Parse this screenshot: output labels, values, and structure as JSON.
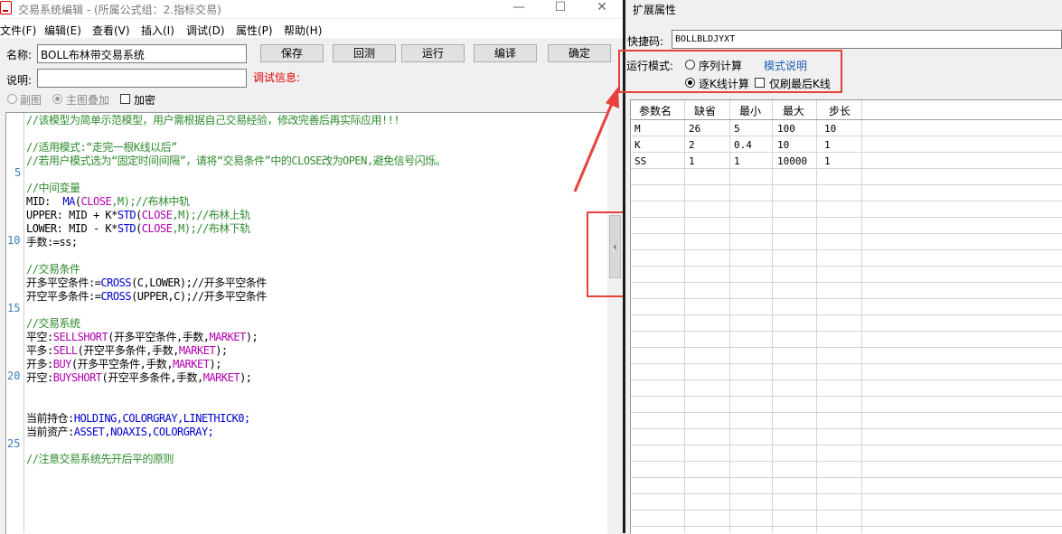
{
  "window": {
    "title": "交易系统编辑 - (所属公式组：2.指标交易)",
    "minimize": "—",
    "maximize": "☐",
    "close": "✕"
  },
  "menu": [
    "文件(F)",
    "编辑(E)",
    "查看(V)",
    "插入(I)",
    "调试(D)",
    "属性(P)",
    "帮助(H)"
  ],
  "form": {
    "name_label": "名称:",
    "name_value": "BOLL布林带交易系统",
    "desc_label": "说明:",
    "desc_value": "",
    "debug_info": "调试信息:",
    "buttons": {
      "save": "保存",
      "backtest": "回测",
      "run": "运行",
      "compile": "编译",
      "ok": "确定"
    },
    "sub_chart": "副图",
    "main_overlay": "主图叠加",
    "encrypt": "加密"
  },
  "editor": {
    "line_numbers": [
      "5",
      "10",
      "15",
      "20",
      "25"
    ],
    "lines": [
      "//该模型为简单示范模型，用户需根据自己交易经验，修改完善后再实际应用!!!",
      "//适用模式:“走完一根K线以后”",
      "//若用户模式选为“固定时间间隔”，请将“交易条件”中的CLOSE改为OPEN,避免信号闪烁。",
      "//中间变量",
      "MID:",
      "MA",
      "(",
      "CLOSE",
      ",M);//布林中轨",
      "UPPER: MID + K*",
      "STD",
      "(",
      "CLOSE",
      ",M);//布林上轨",
      "LOWER: MID - K*",
      "STD",
      "(",
      "CLOSE",
      ",M);//布林下轨",
      "手数:=ss;",
      "//交易条件",
      "开多平空条件:=",
      "CROSS",
      "(C,LOWER);//开多平空条件",
      "开空平多条件:=",
      "CROSS",
      "(UPPER,C);//开多平空条件",
      "//交易系统",
      "平空:",
      "SELLSHORT",
      "(开多平空条件,手数,",
      "MARKET",
      ");",
      "平多:",
      "SELL",
      "(开空平多条件,手数,",
      "MARKET",
      ");",
      "开多:",
      "BUY",
      "(开多平空条件,手数,",
      "MARKET",
      ");",
      "开空:",
      "BUYSHORT",
      "(开空平多条件,手数,",
      "MARKET",
      ");",
      "当前持仓:",
      "HOLDING,COLORGRAY,LINETHICK0;",
      "当前资产:",
      "ASSET,NOAXIS,COLORGRAY;",
      "//注意交易系统先开后平的原则"
    ]
  },
  "panel": {
    "title": "扩展属性",
    "shortcut_label": "快捷码:",
    "shortcut_value": "BOLLBLDJYXT",
    "mode_label": "运行模式:",
    "mode_series": "序列计算",
    "mode_tick": "逐K线计算",
    "mode_help": "模式说明",
    "last_bar_only": "仅刷最后K线",
    "collapse_glyph": "‹",
    "table_headers": [
      "参数名",
      "缺省",
      "最小",
      "最大",
      "步长"
    ],
    "table_rows": [
      [
        "M",
        "26",
        "5",
        "100",
        "10"
      ],
      [
        "K",
        "2",
        "0.4",
        "10",
        "1"
      ],
      [
        "SS",
        "1",
        "1",
        "10000",
        "1"
      ]
    ]
  },
  "colors": {
    "annotation_red": "#e8413a",
    "comment_green": "#2e8b2e",
    "keyword_blue": "#0000cc",
    "constant_magenta": "#b000b0",
    "link_blue": "#1a5fb4",
    "debug_red": "#e00000"
  }
}
